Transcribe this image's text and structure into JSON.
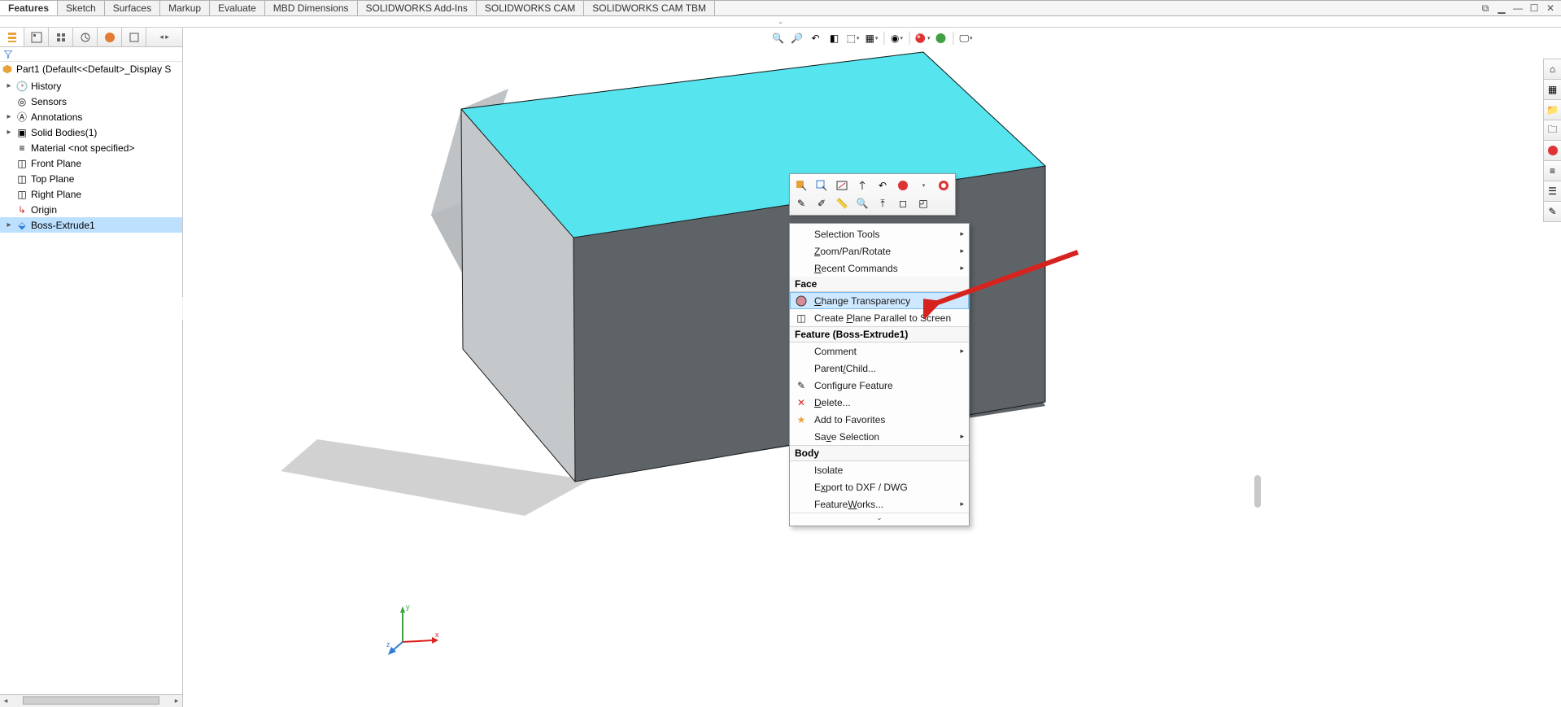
{
  "tabs": {
    "items": [
      "Features",
      "Sketch",
      "Surfaces",
      "Markup",
      "Evaluate",
      "MBD Dimensions",
      "SOLIDWORKS Add-Ins",
      "SOLIDWORKS CAM",
      "SOLIDWORKS CAM TBM"
    ],
    "active": "Features"
  },
  "feature_tree": {
    "root": "Part1  (Default<<Default>_Display S",
    "items": [
      {
        "label": "History",
        "icon": "history-icon",
        "expand": "▸"
      },
      {
        "label": "Sensors",
        "icon": "sensors-icon",
        "expand": ""
      },
      {
        "label": "Annotations",
        "icon": "annotations-icon",
        "expand": "▸"
      },
      {
        "label": "Solid Bodies(1)",
        "icon": "solidbody-icon",
        "expand": "▸"
      },
      {
        "label": "Material <not specified>",
        "icon": "material-icon",
        "expand": ""
      },
      {
        "label": "Front Plane",
        "icon": "plane-icon",
        "expand": ""
      },
      {
        "label": "Top Plane",
        "icon": "plane-icon",
        "expand": ""
      },
      {
        "label": "Right Plane",
        "icon": "plane-icon",
        "expand": ""
      },
      {
        "label": "Origin",
        "icon": "origin-icon",
        "expand": ""
      },
      {
        "label": "Boss-Extrude1",
        "icon": "extrude-icon",
        "expand": "▸",
        "selected": true
      }
    ]
  },
  "context_menu": {
    "top_items": [
      {
        "label": "Selection Tools",
        "sub": true
      },
      {
        "label": "Zoom/Pan/Rotate",
        "sub": true,
        "mn": "Z"
      },
      {
        "label": "Recent Commands",
        "sub": true,
        "mn": "R"
      }
    ],
    "face_header": "Face",
    "face_items": [
      {
        "label": "Change Transparency",
        "mn": "C",
        "icon": "transparency-icon",
        "highlight": true
      },
      {
        "label": "Create Plane Parallel to Screen",
        "mn": "P",
        "icon": "create-plane-icon"
      }
    ],
    "feature_header": "Feature (Boss-Extrude1)",
    "feature_items": [
      {
        "label": "Comment",
        "sub": true
      },
      {
        "label": "Parent/Child...",
        "mn": "/"
      },
      {
        "label": "Configure Feature",
        "icon": "configure-icon"
      },
      {
        "label": "Delete...",
        "mn": "D",
        "icon": "delete-icon"
      },
      {
        "label": "Add to Favorites",
        "icon": "favorite-icon"
      },
      {
        "label": "Save Selection",
        "mn": "v",
        "sub": true
      }
    ],
    "body_header": "Body",
    "body_items": [
      {
        "label": "Isolate"
      },
      {
        "label": "Export to DXF / DWG",
        "mn": "x"
      },
      {
        "label": "FeatureWorks...",
        "mn": "W",
        "sub": true
      }
    ]
  },
  "hud_icons": [
    "zoom-fit-icon",
    "zoom-area-icon",
    "prev-view-icon",
    "section-icon",
    "view-orient-icon",
    "display-style-icon",
    "sep",
    "hide-show-icon",
    "sep",
    "edit-appearance-icon",
    "sep",
    "apply-scene-icon",
    "render-icon",
    "sep",
    "view-settings-icon"
  ],
  "taskpane_icons": [
    "home-icon",
    "resources-icon",
    "library-icon",
    "file-explorer-icon",
    "view-palette-icon",
    "appearances-icon",
    "custom-props-icon",
    "forum-icon"
  ],
  "triad_labels": {
    "x": "x",
    "y": "y",
    "z": "z"
  }
}
